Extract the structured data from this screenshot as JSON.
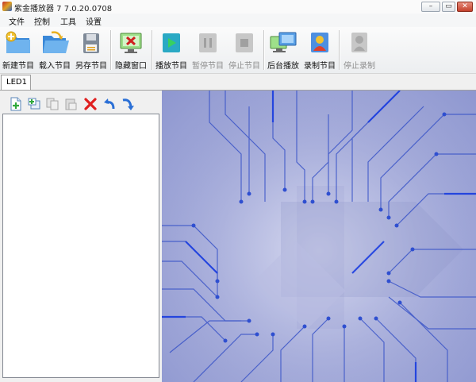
{
  "window": {
    "title": "紫金播放器 7 7.0.20.0708",
    "minimize": "–",
    "restore": "▭",
    "close": "✕"
  },
  "menu": [
    "文件",
    "控制",
    "工具",
    "设置"
  ],
  "toolbar": {
    "new_program": "新建节目",
    "load_program": "载入节目",
    "save_as_program": "另存节目",
    "hide_window": "隐藏窗口",
    "play_program": "播放节目",
    "pause_program": "暂停节目",
    "stop_program": "停止节目",
    "background_play": "后台播放",
    "record_program": "录制节目",
    "stop_recording": "停止录制"
  },
  "tabs": [
    "LED1"
  ],
  "colors": {
    "accent": "#2a6fd6",
    "preview_base": "#a9afdb",
    "circuit_trace": "#3b55c8"
  }
}
